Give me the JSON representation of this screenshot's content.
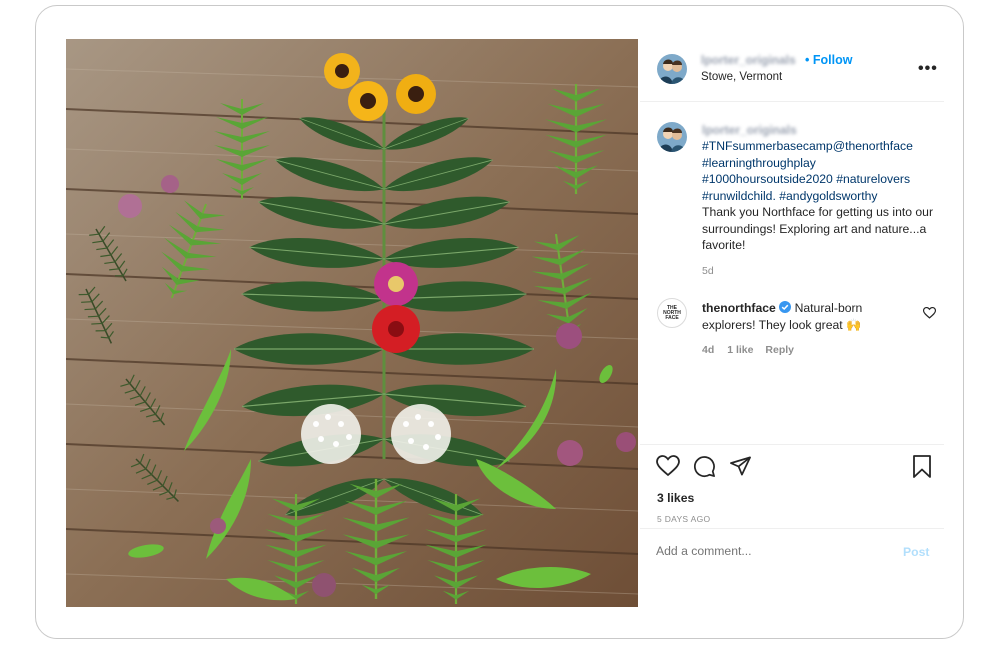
{
  "post": {
    "username": "lporter_originals",
    "follow_label": "• Follow",
    "location": "Stowe, Vermont",
    "more_label": "•••"
  },
  "caption": {
    "username": "lporter_originals",
    "line1": "#TNFsummerbasecamp@thenorthface",
    "line2": "#learningthroughplay",
    "line3a": "#1000hoursoutside2020",
    "line3b": "#naturelovers",
    "line4a": "#runwildchild.",
    "line4b": "#andygoldsworthy",
    "text": "Thank you Northface for getting us into our surroundings! Exploring art and nature...a favorite!",
    "age": "5d"
  },
  "comment": {
    "avatar_text": "THE NORTH FACE",
    "username": "thenorthface",
    "text": "Natural-born explorers! They look great 🙌",
    "age": "4d",
    "likes": "1 like",
    "reply_label": "Reply"
  },
  "engagement": {
    "likes": "3 likes",
    "date": "5 DAYS AGO"
  },
  "add_comment": {
    "placeholder": "Add a comment...",
    "post_label": "Post"
  },
  "colors": {
    "link_blue": "#0095f6",
    "hashtag_blue": "#00376b",
    "verified_blue": "#3897f0",
    "muted": "#8e8e8e"
  },
  "icons": [
    "heart-icon",
    "comment-icon",
    "share-icon",
    "bookmark-icon",
    "verified-icon",
    "more-icon"
  ]
}
